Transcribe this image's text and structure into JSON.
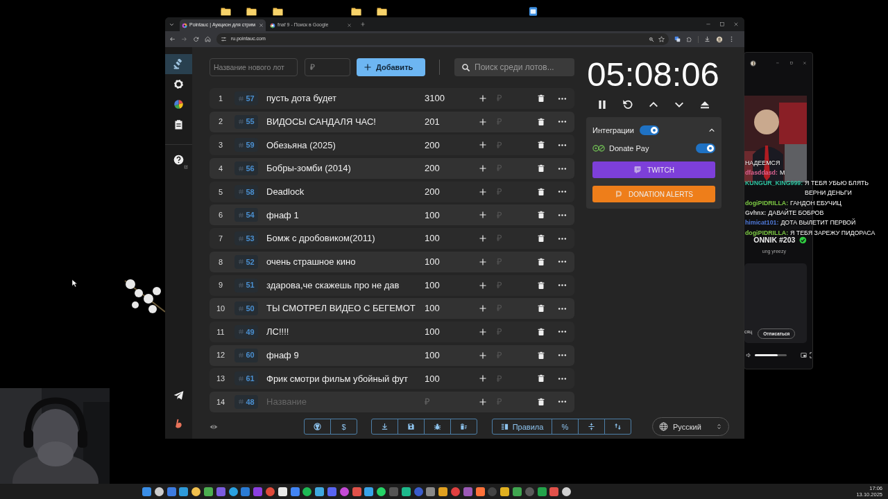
{
  "browser": {
    "tabs": [
      {
        "title": "Pointauc | Аукцион для стрим",
        "selected": true
      },
      {
        "title": "fnaf 9 - Поиск в Google",
        "selected": false
      }
    ],
    "url": "ru.pointauc.com"
  },
  "sidebar": {
    "items": [
      {
        "kind": "auction",
        "selected": true
      },
      {
        "kind": "settings",
        "selected": false
      },
      {
        "kind": "stats",
        "selected": false
      },
      {
        "kind": "history",
        "selected": false
      },
      {
        "kind": "help",
        "selected": false
      }
    ],
    "footer": [
      {
        "kind": "telegram"
      },
      {
        "kind": "support"
      }
    ]
  },
  "new_lot": {
    "name_placeholder": "Название нового лот",
    "amount_placeholder": "₽",
    "add_button": "Добавить"
  },
  "search": {
    "placeholder": "Поиск среди лотов..."
  },
  "lots": [
    {
      "number": "1",
      "id": "57",
      "name": "пусть дота будет",
      "amount": "3100",
      "add_placeholder": "₽"
    },
    {
      "number": "2",
      "id": "55",
      "name": "ВИДОСЫ САНДАЛЯ ЧАС!",
      "amount": "201",
      "add_placeholder": "₽"
    },
    {
      "number": "3",
      "id": "59",
      "name": "Обезьяна (2025)",
      "amount": "200",
      "add_placeholder": "₽"
    },
    {
      "number": "4",
      "id": "56",
      "name": "Бобры-зомби (2014)",
      "amount": "200",
      "add_placeholder": "₽"
    },
    {
      "number": "5",
      "id": "58",
      "name": "Deadlock",
      "amount": "200",
      "add_placeholder": "₽"
    },
    {
      "number": "6",
      "id": "54",
      "name": "фнаф 1",
      "amount": "100",
      "add_placeholder": "₽"
    },
    {
      "number": "7",
      "id": "53",
      "name": "Бомж с дробовиком(2011)",
      "amount": "100",
      "add_placeholder": "₽"
    },
    {
      "number": "8",
      "id": "52",
      "name": "очень страшное кино",
      "amount": "100",
      "add_placeholder": "₽"
    },
    {
      "number": "9",
      "id": "51",
      "name": "здарова,че скажешь про не дав",
      "amount": "100",
      "add_placeholder": "₽"
    },
    {
      "number": "10",
      "id": "50",
      "name": "ТЫ СМОТРЕЛ ВИДЕО С БЕГЕМОТ",
      "amount": "100",
      "add_placeholder": "₽"
    },
    {
      "number": "11",
      "id": "49",
      "name": "ЛС!!!!",
      "amount": "100",
      "add_placeholder": "₽"
    },
    {
      "number": "12",
      "id": "60",
      "name": "фнаф 9",
      "amount": "100",
      "add_placeholder": "₽"
    },
    {
      "number": "13",
      "id": "61",
      "name": "Фрик смотри фильм убойный фут",
      "amount": "100",
      "add_placeholder": "₽"
    },
    {
      "number": "14",
      "id": "48",
      "name_placeholder": "Название",
      "amount_placeholder": "₽",
      "add_placeholder": "₽"
    }
  ],
  "timer": {
    "time": "05:08:06"
  },
  "integrations": {
    "title": "Интеграции",
    "on": true,
    "expanded": true,
    "items": [
      {
        "name": "Donate Pay",
        "on": true
      }
    ],
    "buttons": [
      {
        "label": "TWITCH",
        "kind": "twitch"
      },
      {
        "label": "DONATION ALERTS",
        "kind": "donationalerts"
      }
    ]
  },
  "toolbar": {
    "donate_button": "$",
    "rules_button": "Правила",
    "percent_button": "%",
    "language": "Русский"
  },
  "stream_window": {
    "chat": [
      {
        "text": "НАДЕЕМСЯ"
      },
      {
        "user": "dfasddasd:",
        "color": "#d8618f",
        "text": "М"
      },
      {
        "user": "KUNGUR_KING999:",
        "color": "#2ec4a1",
        "text": "Я ТЕБЯ УБЬЮ БЛЯТЬ ВЕРНИ ДЕНЬГИ"
      },
      {
        "user": "dogiPIDRILLA:",
        "color": "#7cc843",
        "text": "ГАНДОН ЕБУЧИЦ"
      },
      {
        "user": "Gvhnx:",
        "color": "#c9c9c9",
        "text": "ДАВАЙТЕ БОБРОВ"
      },
      {
        "user": "himicat101:",
        "color": "#4f79d9",
        "text": "ДОТА ВЫЛЕТИТ ПЕРВОЙ"
      },
      {
        "user": "dogiPIDRILLA:",
        "color": "#7cc843",
        "text": "Я ТЕБЯ ЗАРЕЖУ ПИДОРАСА"
      }
    ],
    "channel_title": "ONNIK #203",
    "verified": true,
    "subtitle": "ung yreezy",
    "period": "сяц",
    "unsubscribe_button": "Отписаться",
    "volume": {
      "level": 0.72
    }
  },
  "taskbar": {
    "time": "17:06",
    "date": "13.10.2025"
  }
}
